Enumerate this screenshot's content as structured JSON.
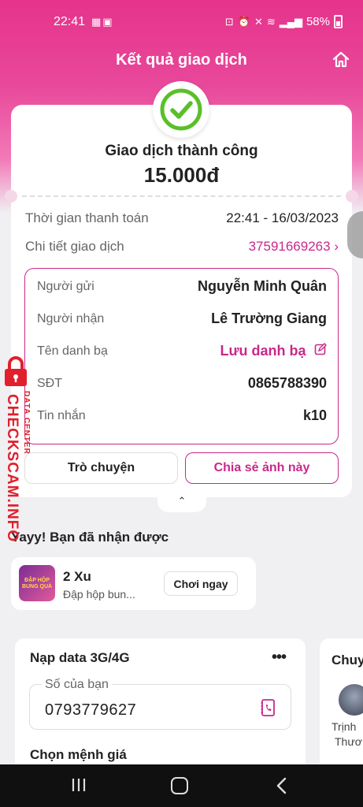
{
  "status_bar": {
    "time": "22:41",
    "battery": "58%",
    "left_icons": [
      "mo-icon",
      "image-icon"
    ],
    "right_icons": [
      "lock-icon",
      "alarm-icon",
      "mute-icon",
      "wifi-icon",
      "signal-icon",
      "battery-icon"
    ]
  },
  "header": {
    "title": "Kết quả giao dịch",
    "home_icon": "home-icon"
  },
  "receipt": {
    "status_title": "Giao dịch thành công",
    "amount": "15.000đ",
    "payment_time_label": "Thời gian thanh toán",
    "payment_time_value": "22:41 - 16/03/2023",
    "transaction_label": "Chi tiết giao dịch",
    "transaction_id": "37591669263",
    "details": {
      "sender_label": "Người gửi",
      "sender_value": "Nguyễn Minh Quân",
      "receiver_label": "Người nhận",
      "receiver_value": "Lê Trường Giang",
      "contact_label": "Tên danh bạ",
      "contact_action": "Lưu danh bạ",
      "phone_label": "SĐT",
      "phone_value": "0865788390",
      "message_label": "Tin nhắn",
      "message_value": "k10"
    },
    "chat_button": "Trò chuyện",
    "share_button": "Chia sẻ ảnh này",
    "collapse_glyph": "⌃"
  },
  "reward": {
    "title": "Yayy! Bạn đã nhận được",
    "image_text": "ĐẬP HỘP BUNG QUÀ",
    "count": "2 Xu",
    "desc": "Đập hộp bun...",
    "play_button": "Chơi ngay"
  },
  "data_topup": {
    "title": "Nạp data 3G/4G",
    "more_glyph": "•••",
    "phone_label": "Số của bạn",
    "phone_value": "0793779627",
    "choose_label": "Chọn mệnh giá"
  },
  "side_card": {
    "title": "Chuy",
    "name_line1": "Trịnh",
    "name_line2": "Thươ"
  },
  "watermark": {
    "main": "CHECKSCAM.INFO",
    "sub": "DATA CENTER"
  },
  "colors": {
    "brand_pink": "#c9288b",
    "header_gradient_top": "#e6338c",
    "success_green": "#5bbf2a"
  }
}
